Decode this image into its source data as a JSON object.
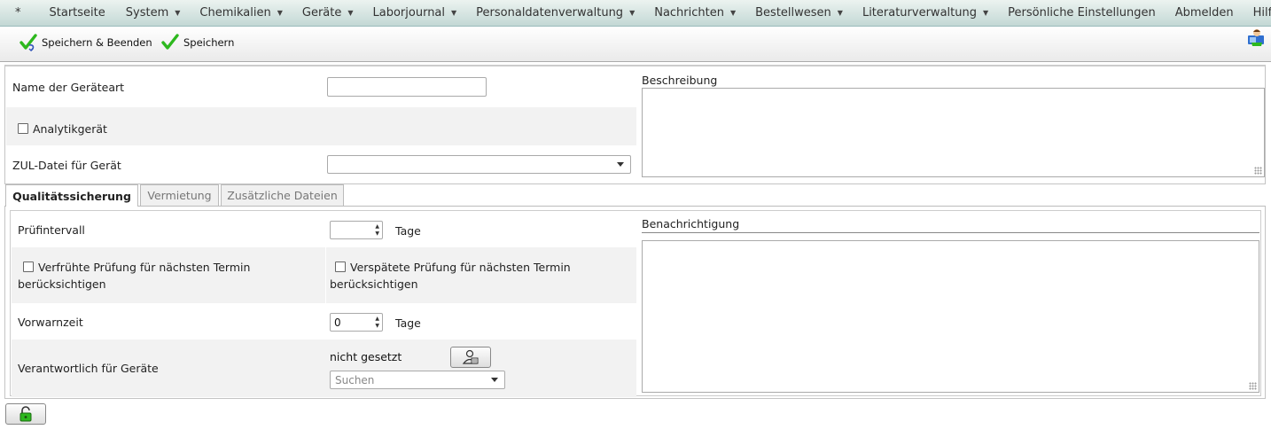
{
  "menu": {
    "star": "*",
    "items": [
      {
        "label": "Startseite",
        "dropdown": false
      },
      {
        "label": "System",
        "dropdown": true
      },
      {
        "label": "Chemikalien",
        "dropdown": true
      },
      {
        "label": "Geräte",
        "dropdown": true
      },
      {
        "label": "Laborjournal",
        "dropdown": true
      },
      {
        "label": "Personaldatenverwaltung",
        "dropdown": true
      },
      {
        "label": "Nachrichten",
        "dropdown": true
      },
      {
        "label": "Bestellwesen",
        "dropdown": true
      },
      {
        "label": "Literaturverwaltung",
        "dropdown": true
      },
      {
        "label": "Persönliche Einstellungen",
        "dropdown": false
      },
      {
        "label": "Abmelden",
        "dropdown": false
      },
      {
        "label": "Hilfe",
        "dropdown": false
      }
    ],
    "dropdown_glyph": "▼"
  },
  "toolbar": {
    "save_close_label": "Speichern & Beenden",
    "save_label": "Speichern"
  },
  "form": {
    "name_label": "Name der Geräteart",
    "name_value": "",
    "analytic_label": "Analytikgerät",
    "zul_label": "ZUL-Datei für Gerät",
    "zul_value": "",
    "description_label": "Beschreibung"
  },
  "tabs": [
    {
      "label": "Qualitätssicherung",
      "active": true
    },
    {
      "label": "Vermietung",
      "active": false
    },
    {
      "label": "Zusätzliche Dateien",
      "active": false
    }
  ],
  "qa": {
    "interval_label": "Prüfintervall",
    "interval_value": "",
    "interval_unit": "Tage",
    "early_label_1": "Verfrühte Prüfung für nächsten Termin",
    "early_label_2": "berücksichtigen",
    "late_label_1": "Verspätete Prüfung für nächsten Termin",
    "late_label_2": "berücksichtigen",
    "warning_label": "Vorwarnzeit",
    "warning_value": "0",
    "warning_unit": "Tage",
    "responsible_label": "Verantwortlich für Geräte",
    "responsible_value": "nicht gesetzt",
    "search_placeholder": "Suchen",
    "notification_label": "Benachrichtigung"
  },
  "colors": {
    "menubar_top": "#ecf3f0",
    "menubar_bottom": "#c3d8d5",
    "check_green": "#2db81e",
    "shaded_row": "#f2f2f2"
  },
  "icons": {
    "save_close": "check-arrow-icon",
    "save": "check-icon",
    "corner": "user-card-icon",
    "lock": "unlock-icon",
    "pick_person": "person-select-icon"
  }
}
